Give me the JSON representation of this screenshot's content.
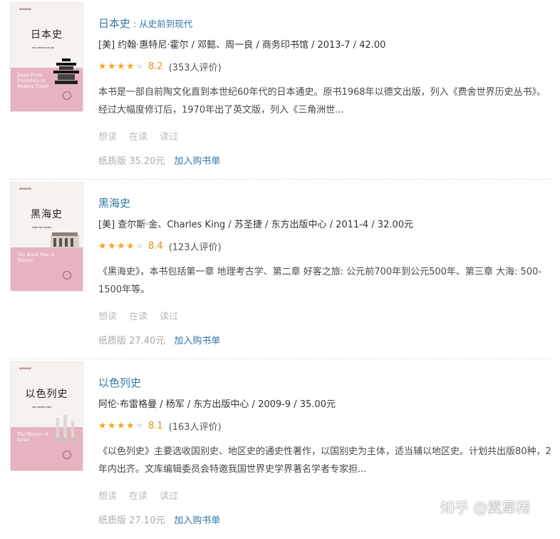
{
  "books": [
    {
      "title": "日本史",
      "subtitle": "从史前到现代",
      "meta": "[美] 约翰·惠特尼·霍尔 / 邓懿、周一良 / 商务印书馆 / 2013-7 / 42.00",
      "rating_score": "8.2",
      "rating_stars": 4,
      "rating_count": "(353人评价)",
      "description": "本书是一部自前陶文化直到本世纪60年代的日本通史。原书1968年以德文出版，列入《费舍世界历史丛书》。经过大幅度修订后，1970年出了英文版，列入《三角洲世...",
      "actions": [
        "想读",
        "在读",
        "读过"
      ],
      "price": "纸质版 35.20元",
      "cart_label": "加入购书单",
      "cover": {
        "title": "日本史",
        "english": "Japan:From Prehistory to Modern Times"
      }
    },
    {
      "title": "黑海史",
      "subtitle": "",
      "meta": "[美] 查尔斯·金、Charles King / 苏圣捷 / 东方出版中心 / 2011-4 / 32.00元",
      "rating_score": "8.4",
      "rating_stars": 4,
      "rating_count": "(123人评价)",
      "description": "《黑海史》，本书包括第一章 地理考古学、第二章 好客之旅: 公元前700年到公元500年、第三章 大海: 500-1500年等。",
      "actions": [
        "想读",
        "在读",
        "读过"
      ],
      "price": "纸质版 27.40元",
      "cart_label": "加入购书单",
      "cover": {
        "title": "黑海史",
        "english": "The Black Sea: A History"
      }
    },
    {
      "title": "以色列史",
      "subtitle": "",
      "meta": "阿伦·布雷格曼 / 杨军 / 东方出版中心 / 2009-9 / 35.00元",
      "rating_score": "8.1",
      "rating_stars": 4,
      "rating_count": "(163人评价)",
      "description": "《以色列史》主要选收国别史、地区史的通史性著作，以国别史为主体，适当辅以地区史。计划共出版80种，2年内出齐。文库编辑委员会特邀我国世界史学界著名学者专家担...",
      "actions": [
        "想读",
        "在读",
        "读过"
      ],
      "price": "纸质版 27.10元",
      "cart_label": "加入购书单",
      "cover": {
        "title": "以色列史",
        "english": "The History of Israel"
      }
    }
  ],
  "watermark": "知乎 @翼犀稀",
  "colors": {
    "link": "#3377aa",
    "star": "#f5a623",
    "score": "#e09015",
    "muted": "#bbbbbb"
  }
}
